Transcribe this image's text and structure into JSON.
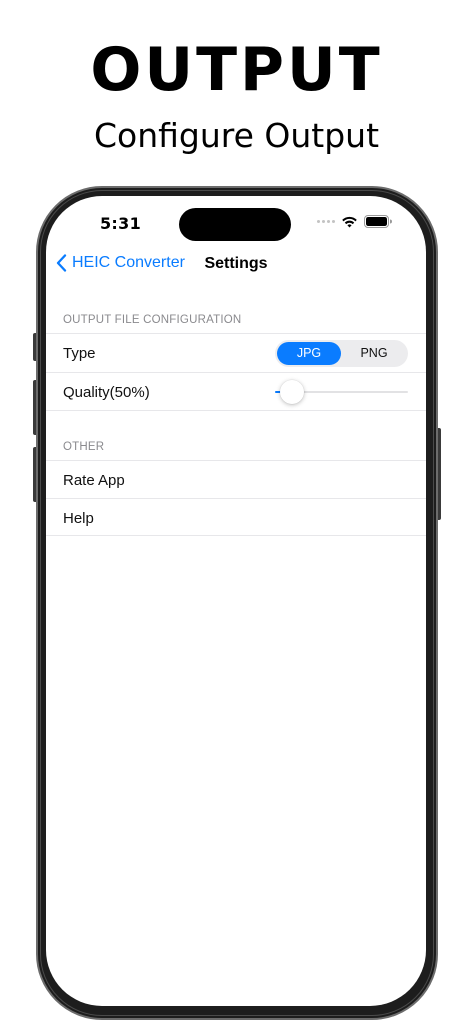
{
  "header": {
    "title": "OUTPUT",
    "subtitle": "Configure Output"
  },
  "status_bar": {
    "time": "5:31"
  },
  "nav": {
    "back_label": "HEIC Converter",
    "title": "Settings"
  },
  "output_section": {
    "header": "OUTPUT FILE CONFIGURATION",
    "type_row": {
      "label": "Type",
      "options": [
        "JPG",
        "PNG"
      ],
      "selected": "JPG"
    },
    "quality_row": {
      "label": "Quality(50%)",
      "slider_value": 0.05
    }
  },
  "other_section": {
    "header": "OTHER",
    "items": [
      {
        "label": "Rate App"
      },
      {
        "label": "Help"
      }
    ]
  },
  "colors": {
    "accent": "#0a7cff",
    "section_header": "#8a8a8e",
    "separator": "#e7e7ea"
  }
}
